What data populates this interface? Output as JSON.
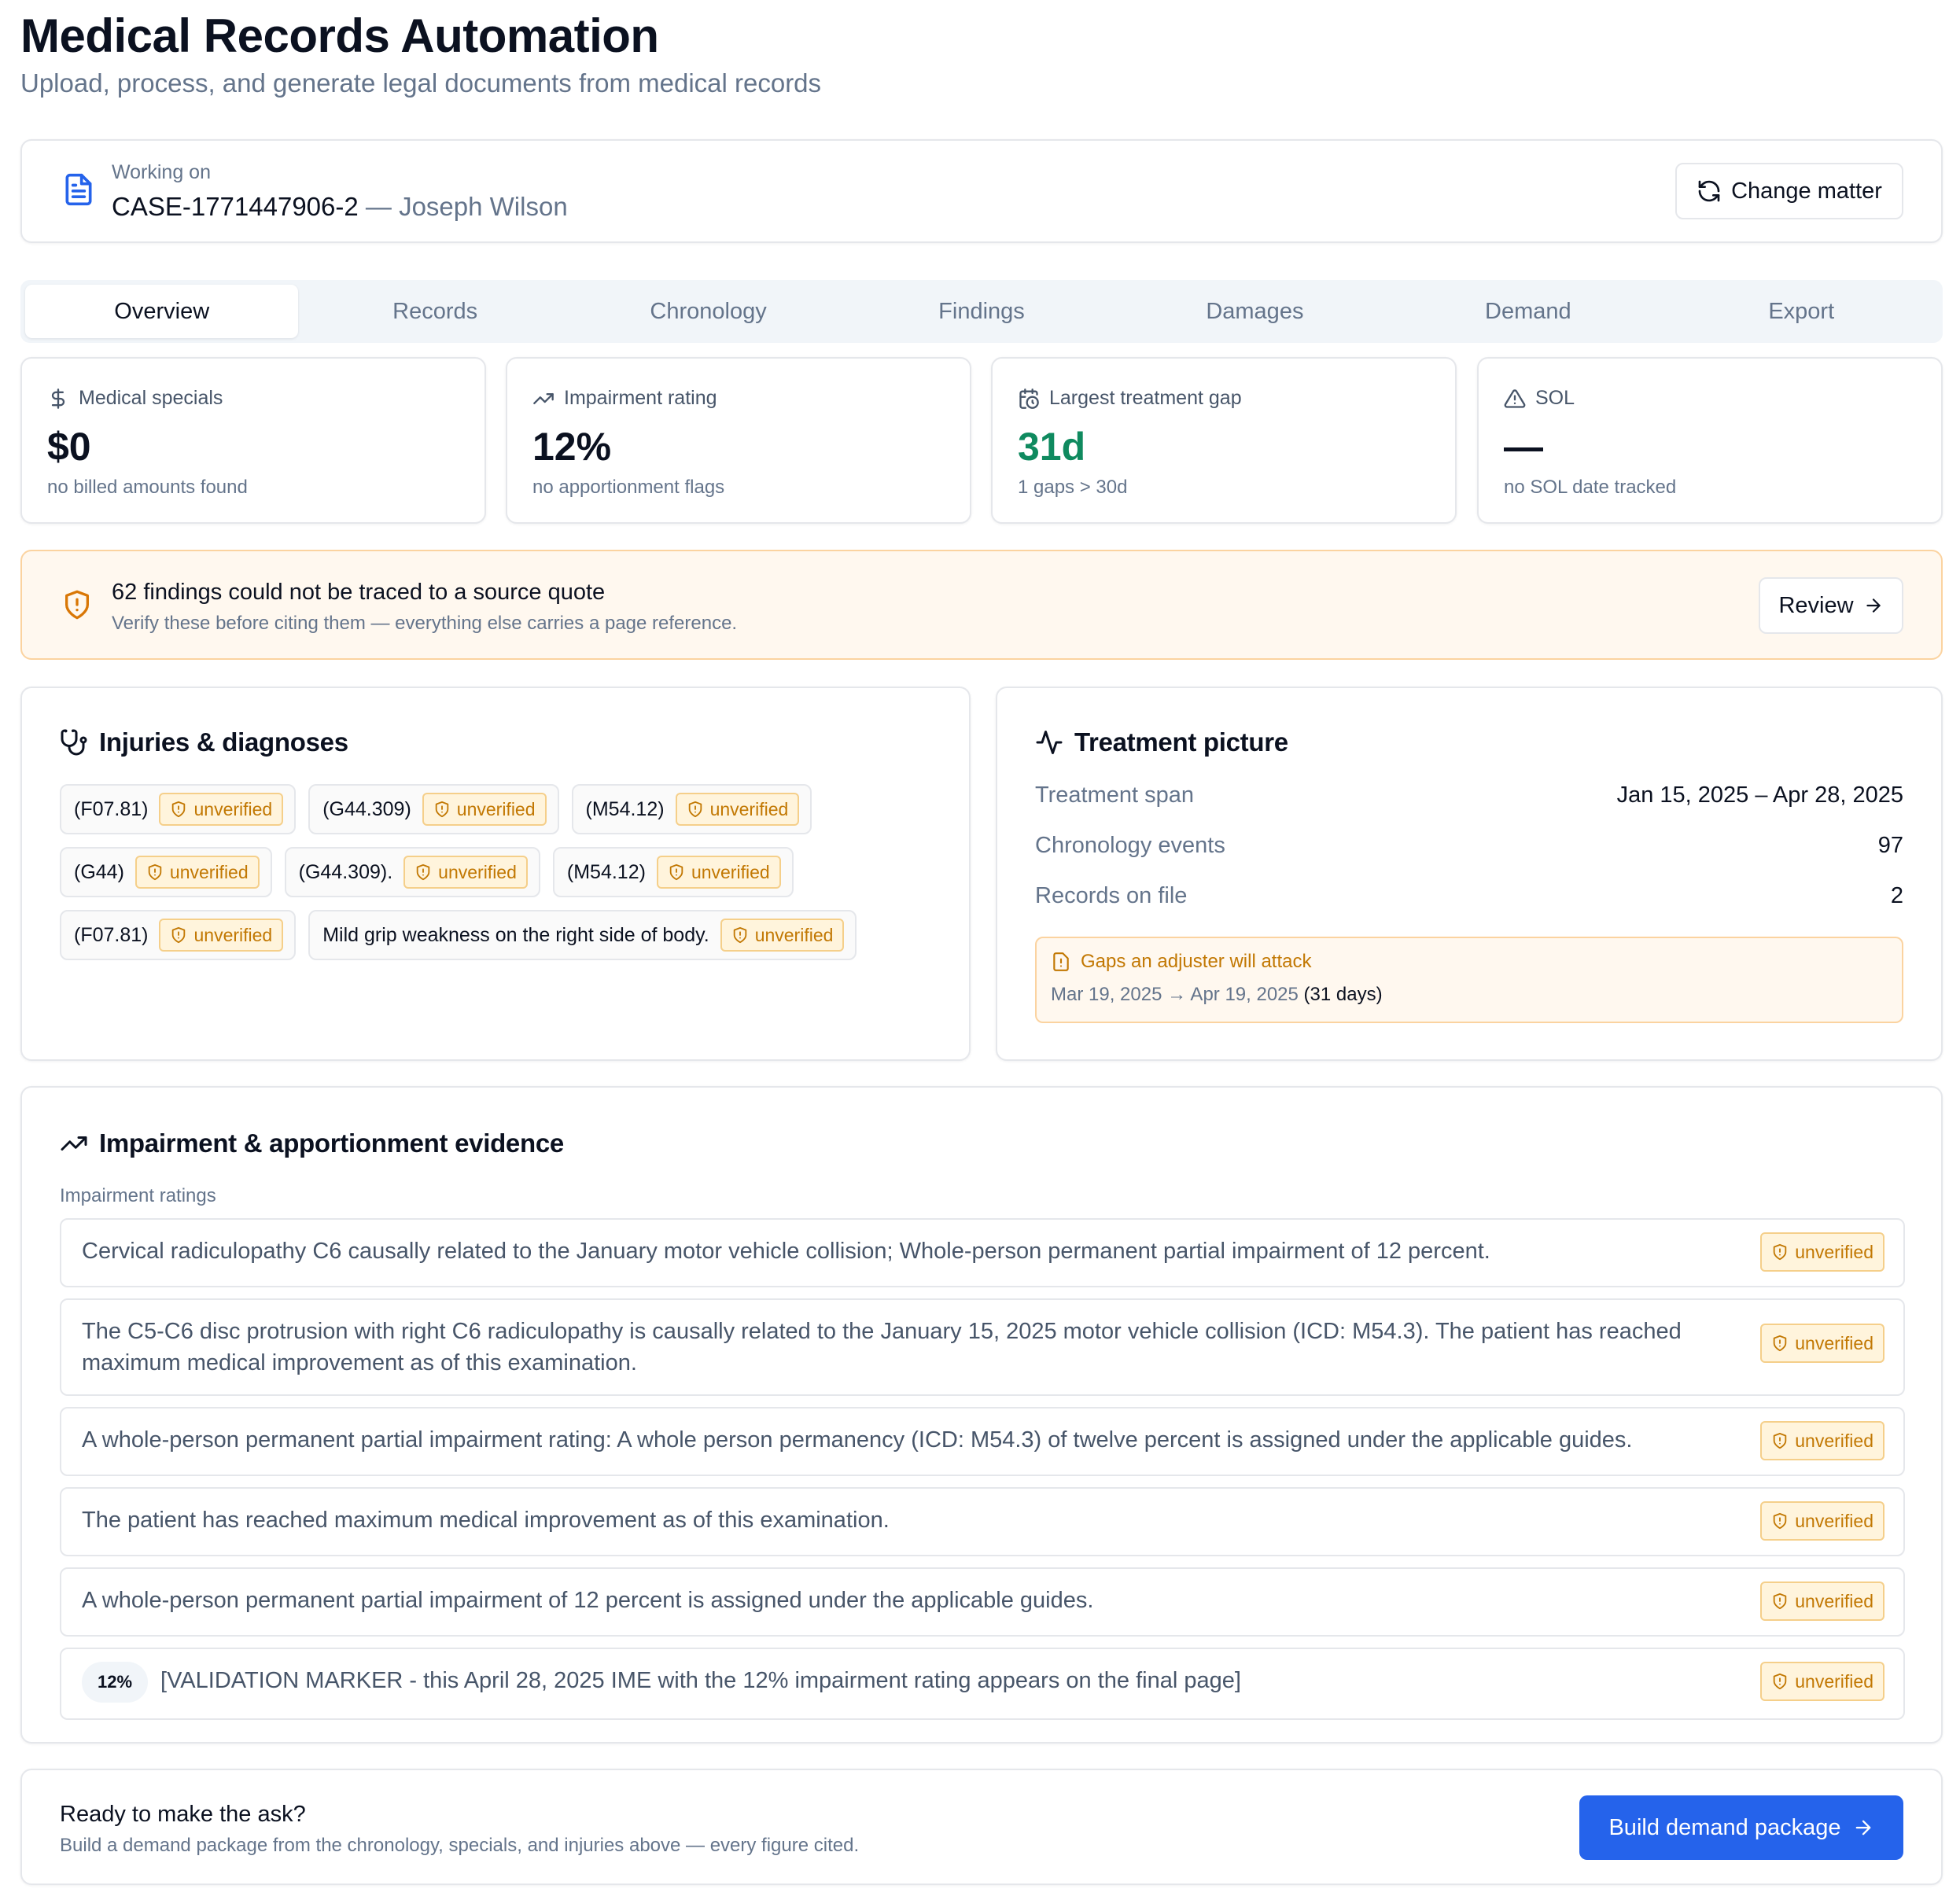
{
  "header": {
    "title": "Medical Records Automation",
    "subtitle": "Upload, process, and generate legal documents from medical records"
  },
  "matter": {
    "working_label": "Working on",
    "case_id": "CASE-1771447906-2",
    "separator": " — ",
    "client": "Joseph Wilson",
    "change_button": "Change matter"
  },
  "tabs": [
    "Overview",
    "Records",
    "Chronology",
    "Findings",
    "Damages",
    "Demand",
    "Export"
  ],
  "active_tab": "Overview",
  "stats": [
    {
      "icon": "dollar-icon",
      "label": "Medical specials",
      "value": "$0",
      "note": "no billed amounts found"
    },
    {
      "icon": "trending-up-icon",
      "label": "Impairment rating",
      "value": "12%",
      "note": "no apportionment flags"
    },
    {
      "icon": "calendar-clock-icon",
      "label": "Largest treatment gap",
      "value": "31d",
      "note": "1 gaps > 30d",
      "value_color": "#0f8a5f"
    },
    {
      "icon": "alert-triangle-icon",
      "label": "SOL",
      "value": "—",
      "note": "no SOL date tracked"
    }
  ],
  "alert": {
    "title": "62 findings could not be traced to a source quote",
    "subtitle": "Verify these before citing them — everything else carries a page reference.",
    "button": "Review"
  },
  "injuries": {
    "title": "Injuries & diagnoses",
    "badge_label": "unverified",
    "chips": [
      {
        "label": "(F07.81)",
        "status": "unverified"
      },
      {
        "label": "(G44.309)",
        "status": "unverified"
      },
      {
        "label": "(M54.12)",
        "status": "unverified"
      },
      {
        "label": "(G44)",
        "status": "unverified"
      },
      {
        "label": "(G44.309).",
        "status": "unverified"
      },
      {
        "label": "(M54.12)",
        "status": "unverified"
      },
      {
        "label": "(F07.81)",
        "status": "unverified"
      },
      {
        "label": "Mild grip weakness on the right side of body.",
        "status": "unverified"
      }
    ]
  },
  "treatment": {
    "title": "Treatment picture",
    "rows": [
      {
        "key": "Treatment span",
        "value": "Jan 15, 2025 – Apr 28, 2025"
      },
      {
        "key": "Chronology events",
        "value": "97"
      },
      {
        "key": "Records on file",
        "value": "2"
      }
    ],
    "gaps_title": "Gaps an adjuster will attack",
    "gap_range": "Mar 19, 2025 → Apr 19, 2025",
    "gap_days": "(31 days)"
  },
  "impairment": {
    "title": "Impairment & apportionment evidence",
    "sub_label": "Impairment ratings",
    "items": [
      {
        "text": "Cervical radiculopathy C6 causally related to the January motor vehicle collision; Whole-person permanent partial impairment of 12 percent.",
        "status": "unverified"
      },
      {
        "text": "The C5-C6 disc protrusion with right C6 radiculopathy is causally related to the January 15, 2025 motor vehicle collision (ICD: M54.3). The patient has reached maximum medical improvement as of this examination.",
        "status": "unverified"
      },
      {
        "text": "A whole-person permanent partial impairment rating: A whole person permanency (ICD: M54.3) of twelve percent is assigned under the applicable guides.",
        "status": "unverified"
      },
      {
        "text": "The patient has reached maximum medical improvement as of this examination.",
        "status": "unverified"
      },
      {
        "text": "A whole-person permanent partial impairment of 12 percent is assigned under the applicable guides.",
        "status": "unverified"
      },
      {
        "pill": "12%",
        "text": "[VALIDATION MARKER - this April 28, 2025 IME with the 12% impairment rating appears on the final page]",
        "status": "unverified"
      }
    ]
  },
  "ready": {
    "title": "Ready to make the ask?",
    "subtitle": "Build a demand package from the chronology, specials, and injuries above — every figure cited.",
    "button": "Build demand package"
  },
  "colors": {
    "accent": "#2563eb",
    "warning": "#d97706",
    "success": "#0f8a5f"
  }
}
